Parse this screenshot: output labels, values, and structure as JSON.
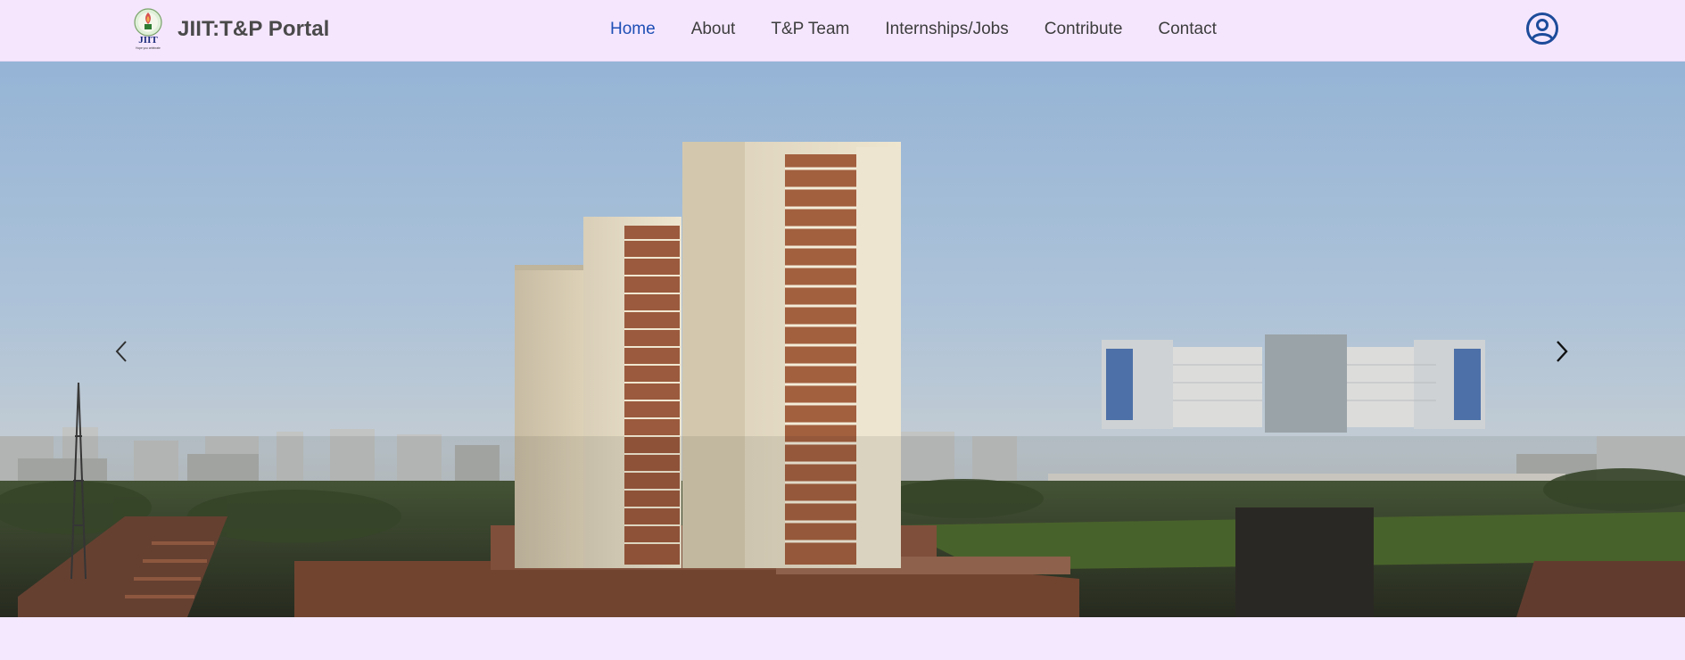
{
  "header": {
    "logo_icon": "jiit-logo",
    "logo_text": "JIIT",
    "logo_tagline": "Hope you celebrate",
    "brand_title": "JIIT:T&P Portal",
    "account_icon": "user-circle-icon"
  },
  "nav": {
    "items": [
      {
        "label": "Home",
        "active": true
      },
      {
        "label": "About",
        "active": false
      },
      {
        "label": "T&P Team",
        "active": false
      },
      {
        "label": "Internships/Jobs",
        "active": false
      },
      {
        "label": "Contribute",
        "active": false
      },
      {
        "label": "Contact",
        "active": false
      }
    ]
  },
  "carousel": {
    "slide_image": "campus-buildings-panorama",
    "prev_icon": "chevron-left-icon",
    "next_icon": "chevron-right-icon"
  },
  "colors": {
    "navbar_bg": "#f5e6fe",
    "page_bg": "#f3e8fd",
    "active_link": "#1e4fb5",
    "link": "#3d3d3d",
    "account_icon": "#1d4b9a"
  }
}
